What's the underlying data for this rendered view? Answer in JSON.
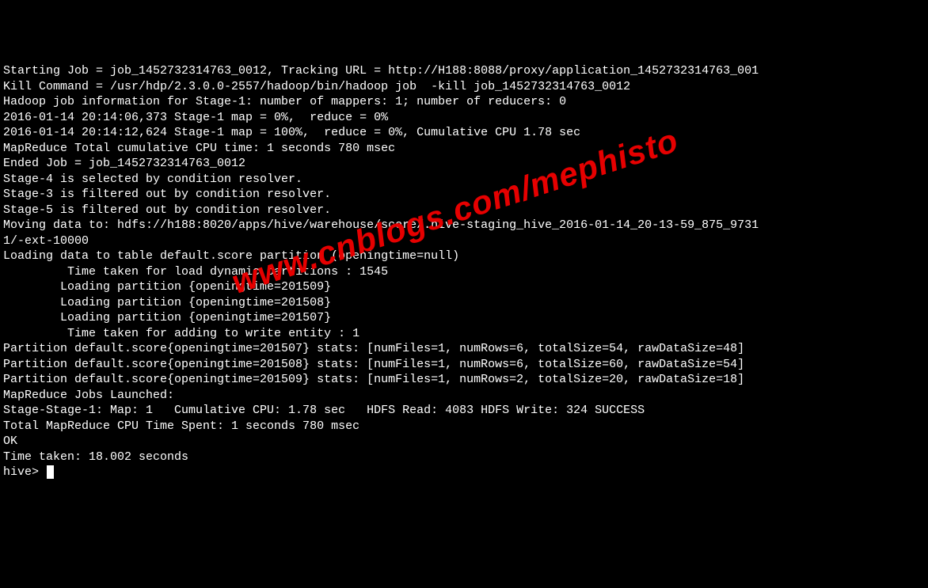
{
  "watermark": "www.cnblogs.com/mephisto",
  "lines": [
    "Starting Job = job_1452732314763_0012, Tracking URL = http://H188:8088/proxy/application_1452732314763_001",
    "Kill Command = /usr/hdp/2.3.0.0-2557/hadoop/bin/hadoop job  -kill job_1452732314763_0012",
    "Hadoop job information for Stage-1: number of mappers: 1; number of reducers: 0",
    "2016-01-14 20:14:06,373 Stage-1 map = 0%,  reduce = 0%",
    "2016-01-14 20:14:12,624 Stage-1 map = 100%,  reduce = 0%, Cumulative CPU 1.78 sec",
    "MapReduce Total cumulative CPU time: 1 seconds 780 msec",
    "Ended Job = job_1452732314763_0012",
    "Stage-4 is selected by condition resolver.",
    "Stage-3 is filtered out by condition resolver.",
    "Stage-5 is filtered out by condition resolver.",
    "Moving data to: hdfs://h188:8020/apps/hive/warehouse/score/.hive-staging_hive_2016-01-14_20-13-59_875_9731",
    "1/-ext-10000",
    "Loading data to table default.score partition (openingtime=null)",
    "\t Time taken for load dynamic partitions : 1545",
    "\tLoading partition {openingtime=201509}",
    "\tLoading partition {openingtime=201508}",
    "\tLoading partition {openingtime=201507}",
    "\t Time taken for adding to write entity : 1",
    "Partition default.score{openingtime=201507} stats: [numFiles=1, numRows=6, totalSize=54, rawDataSize=48]",
    "Partition default.score{openingtime=201508} stats: [numFiles=1, numRows=6, totalSize=60, rawDataSize=54]",
    "Partition default.score{openingtime=201509} stats: [numFiles=1, numRows=2, totalSize=20, rawDataSize=18]",
    "MapReduce Jobs Launched:",
    "Stage-Stage-1: Map: 1   Cumulative CPU: 1.78 sec   HDFS Read: 4083 HDFS Write: 324 SUCCESS",
    "Total MapReduce CPU Time Spent: 1 seconds 780 msec",
    "OK",
    "Time taken: 18.002 seconds"
  ],
  "prompt": "hive> "
}
